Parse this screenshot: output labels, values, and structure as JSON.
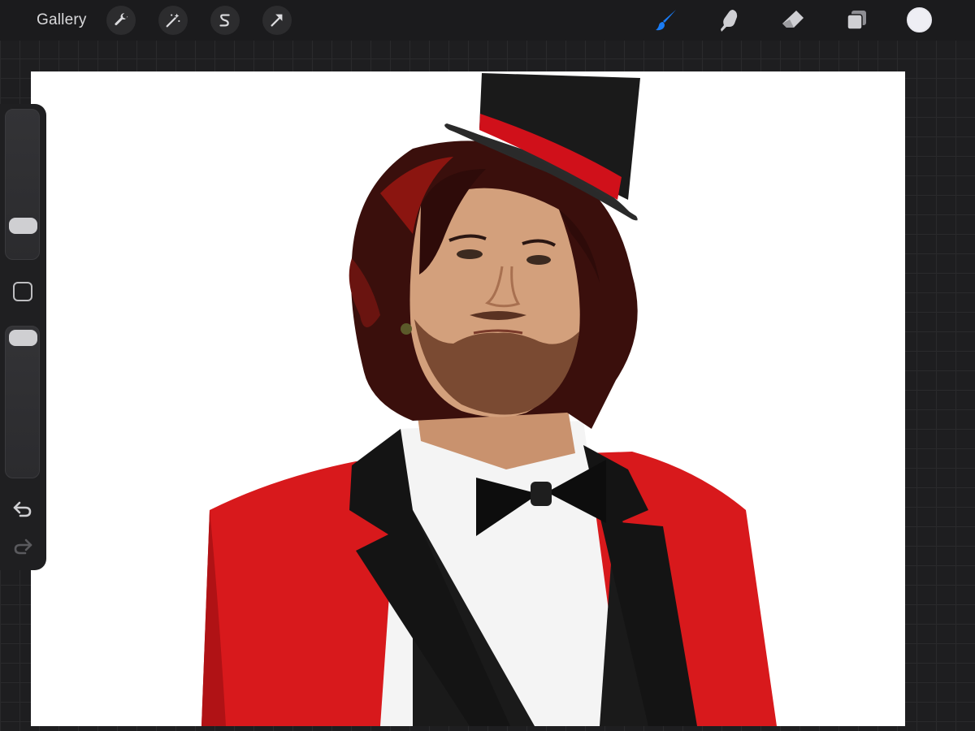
{
  "topbar": {
    "gallery_label": "Gallery",
    "left_tools": [
      {
        "name": "actions",
        "icon": "wrench-icon"
      },
      {
        "name": "adjustments",
        "icon": "magic-wand-icon"
      },
      {
        "name": "selection",
        "icon": "selection-s-icon"
      },
      {
        "name": "transform",
        "icon": "arrow-cursor-icon"
      }
    ],
    "right_tools": [
      {
        "name": "brush",
        "icon": "brush-icon",
        "active": true
      },
      {
        "name": "smudge",
        "icon": "smudge-finger-icon",
        "active": false
      },
      {
        "name": "eraser",
        "icon": "eraser-icon",
        "active": false
      },
      {
        "name": "layers",
        "icon": "layers-icon",
        "active": false
      }
    ],
    "current_color": "#eeeef4"
  },
  "sidebar": {
    "brush_size_level": 0.22,
    "opacity_level": 0.95,
    "icons": [
      "modify-square-icon",
      "undo-icon",
      "redo-icon"
    ]
  },
  "colors": {
    "accent_blue": "#1a7cf5",
    "canvas": "#ffffff",
    "jacket_red": "#d8191c"
  }
}
